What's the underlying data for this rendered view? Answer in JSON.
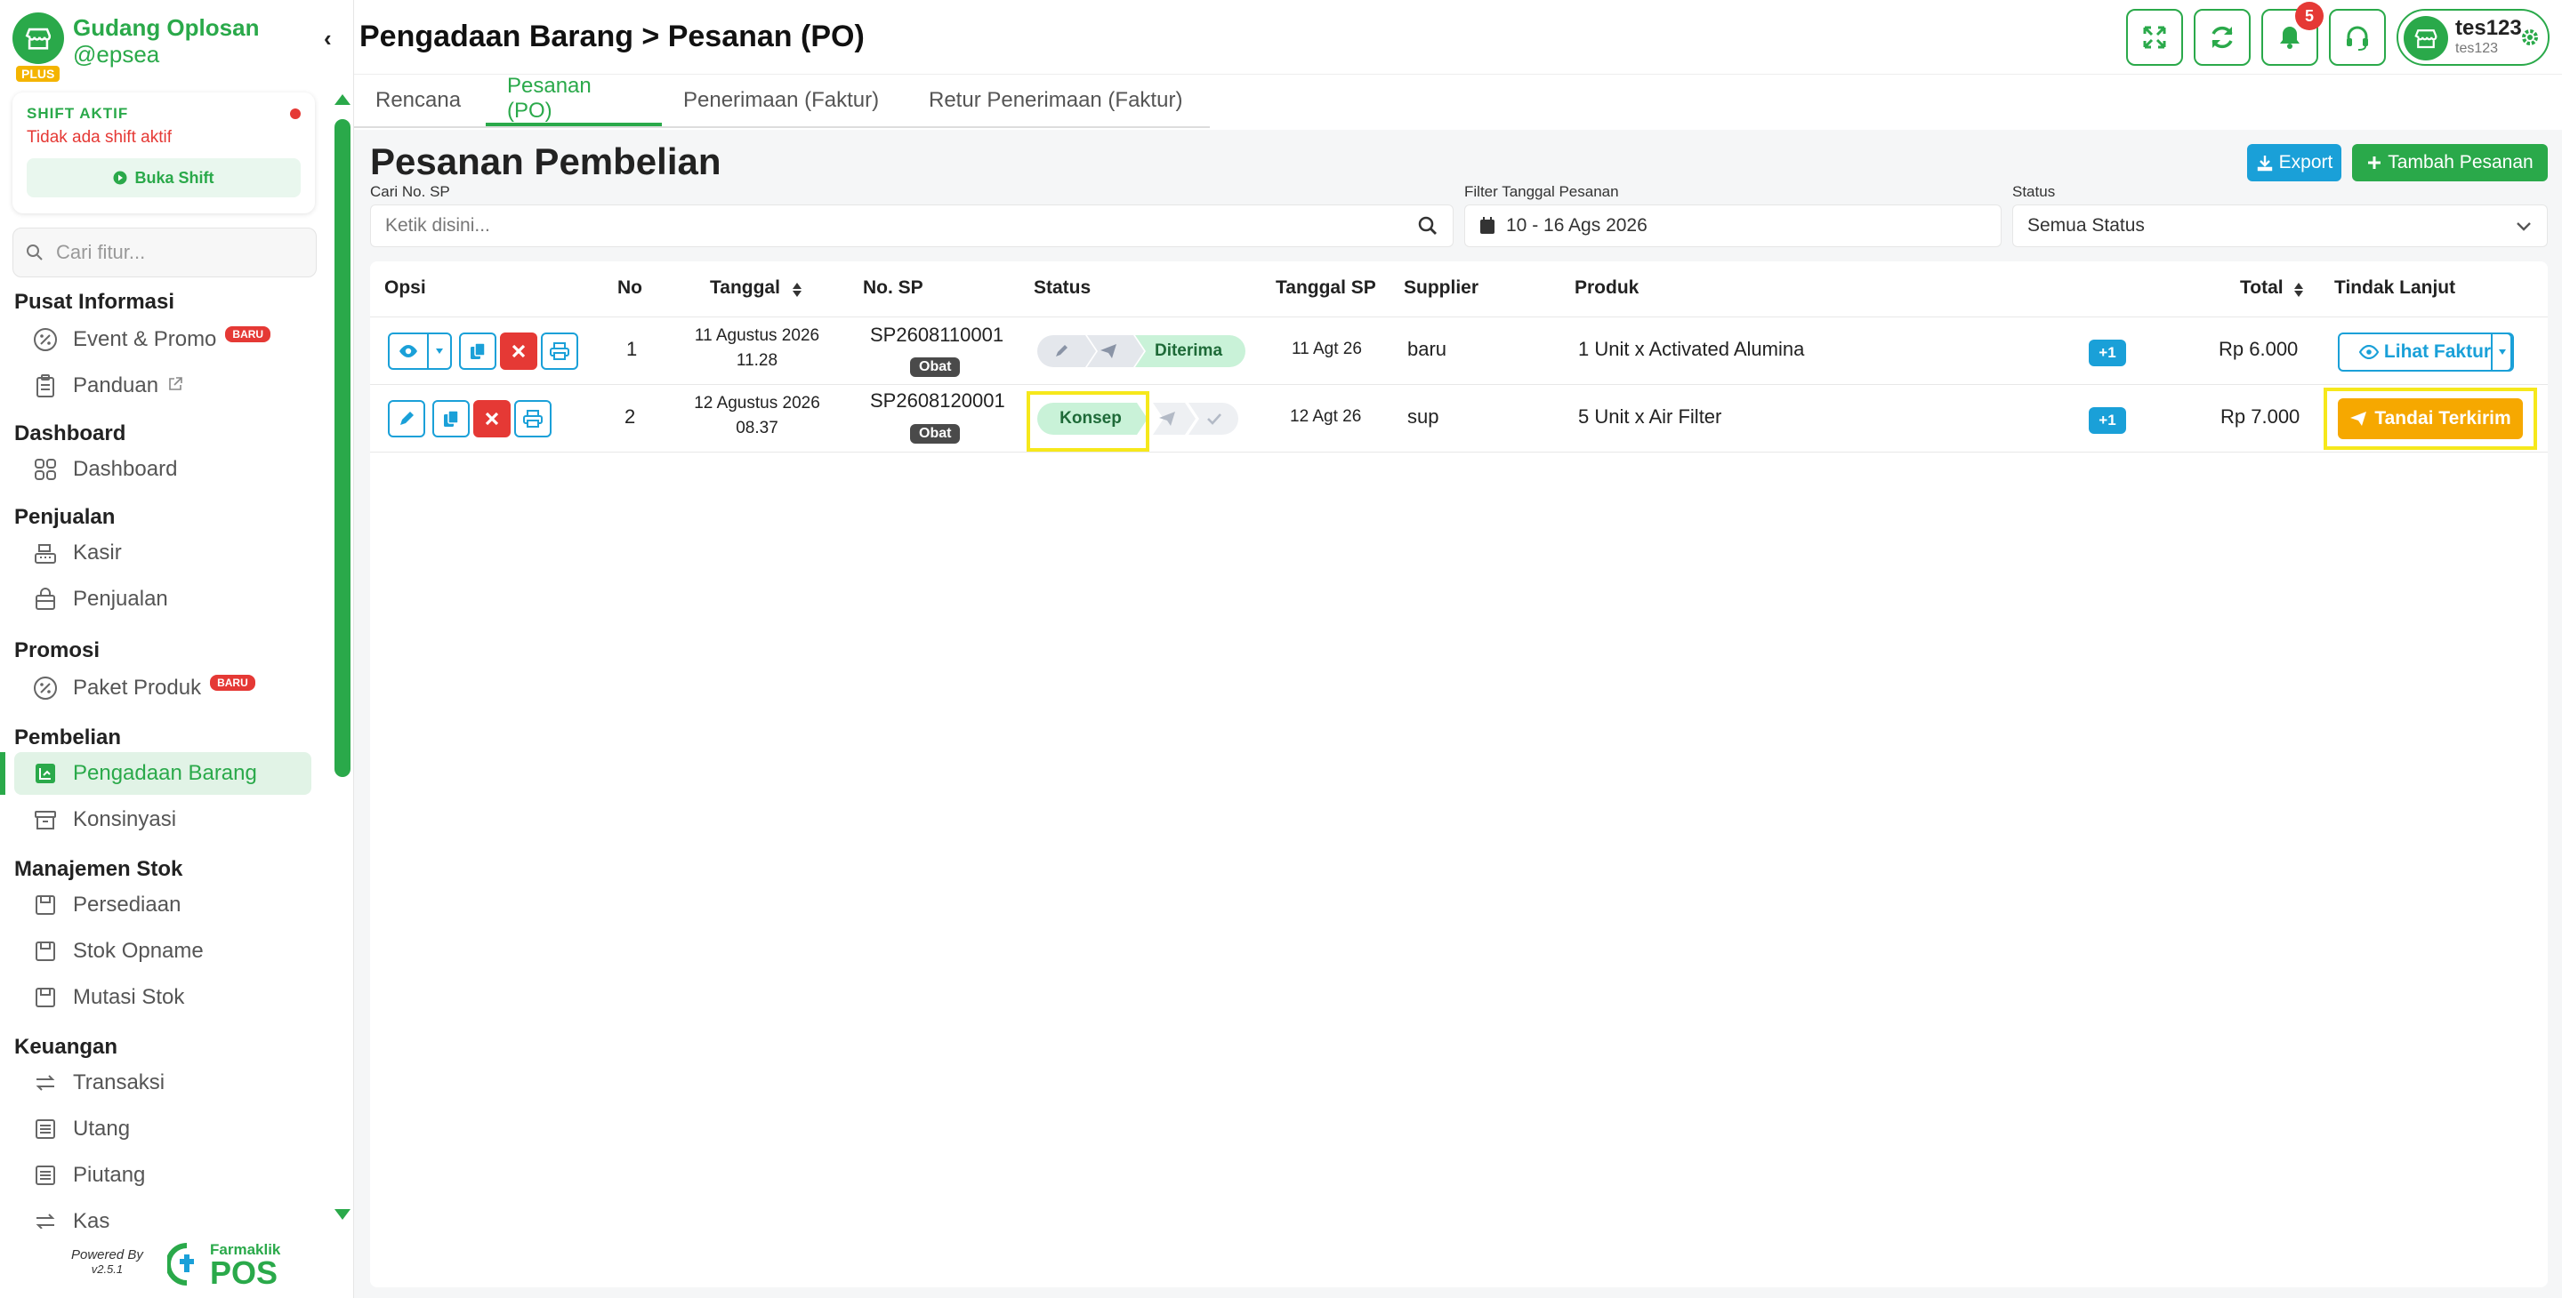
{
  "brand": {
    "name": "Gudang Oplosan",
    "handle": "@epsea",
    "plan": "PLUS"
  },
  "shift": {
    "title": "SHIFT AKTIF",
    "message": "Tidak ada shift aktif",
    "button": "Buka Shift"
  },
  "sidebar_search": {
    "placeholder": "Cari fitur..."
  },
  "menu": {
    "pusat_informasi": "Pusat Informasi",
    "event_promo": "Event & Promo",
    "panduan": "Panduan",
    "dashboard_section": "Dashboard",
    "dashboard": "Dashboard",
    "penjualan_section": "Penjualan",
    "kasir": "Kasir",
    "penjualan": "Penjualan",
    "promosi_section": "Promosi",
    "paket_produk": "Paket Produk",
    "pembelian_section": "Pembelian",
    "pengadaan_barang": "Pengadaan Barang",
    "konsinyasi": "Konsinyasi",
    "stok_section": "Manajemen Stok",
    "persediaan": "Persediaan",
    "stok_opname": "Stok Opname",
    "mutasi_stok": "Mutasi Stok",
    "keuangan_section": "Keuangan",
    "transaksi": "Transaksi",
    "utang": "Utang",
    "piutang": "Piutang",
    "kas": "Kas",
    "badge_new": "BARU"
  },
  "footer": {
    "powered_by": "Powered By",
    "version": "v2.5.1",
    "brand_small": "Farmaklik",
    "brand_big": "POS"
  },
  "header": {
    "breadcrumb": "Pengadaan Barang > Pesanan (PO)",
    "notif_count": "5",
    "user_name": "tes123",
    "user_sub": "tes123"
  },
  "tabs": [
    "Rencana",
    "Pesanan (PO)",
    "Penerimaan (Faktur)",
    "Retur Penerimaan (Faktur)"
  ],
  "main": {
    "title": "Pesanan Pembelian",
    "export_label": "Export",
    "add_label": "Tambah Pesanan"
  },
  "filters": {
    "search_label": "Cari No. SP",
    "search_placeholder": "Ketik disini...",
    "date_label": "Filter Tanggal Pesanan",
    "date_value": "10 - 16 Ags 2026",
    "status_label": "Status",
    "status_value": "Semua Status"
  },
  "table": {
    "headers": [
      "Opsi",
      "No",
      "Tanggal",
      "No. SP",
      "Status",
      "Tanggal SP",
      "Supplier",
      "Produk",
      "Total",
      "Tindak Lanjut"
    ],
    "rows": [
      {
        "no": "1",
        "date": "11 Agustus 2026",
        "time": "11.28",
        "sp": "SP2608110001",
        "tag": "Obat",
        "status": "Diterima",
        "sp_date": "11 Agt 26",
        "supplier": "baru",
        "product": "1 Unit x Activated Alumina",
        "more": "+1",
        "total": "Rp 6.000",
        "action": "Lihat Faktur"
      },
      {
        "no": "2",
        "date": "12 Agustus 2026",
        "time": "08.37",
        "sp": "SP2608120001",
        "tag": "Obat",
        "status": "Konsep",
        "sp_date": "12 Agt 26",
        "supplier": "sup",
        "product": "5 Unit x Air Filter",
        "more": "+1",
        "total": "Rp 7.000",
        "action": "Tandai Terkirim"
      }
    ]
  },
  "colors": {
    "primary": "#2aa94a",
    "info": "#1aa0d8",
    "danger": "#e53935",
    "warning": "#f6a800",
    "highlight": "#f6e81b"
  }
}
